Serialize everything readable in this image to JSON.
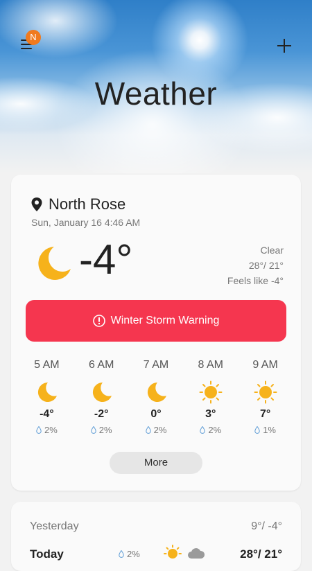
{
  "header": {
    "title": "Weather",
    "badge": "N",
    "menu_icon": "hamburger-icon",
    "add_icon": "plus-icon"
  },
  "current": {
    "location": "North Rose",
    "datetime": "Sun, January 16 4:46 AM",
    "temperature": "-4°",
    "condition": "Clear",
    "high_low": "28°/ 21°",
    "feels_like": "Feels like -4°",
    "icon": "moon-icon"
  },
  "warning": {
    "label": "Winter Storm Warning",
    "icon": "alert-icon",
    "color": "#f5364f"
  },
  "hourly": [
    {
      "time": "5 AM",
      "icon": "moon",
      "temp": "-4°",
      "pop": "2%"
    },
    {
      "time": "6 AM",
      "icon": "moon",
      "temp": "-2°",
      "pop": "2%"
    },
    {
      "time": "7 AM",
      "icon": "moon",
      "temp": "0°",
      "pop": "2%"
    },
    {
      "time": "8 AM",
      "icon": "sun",
      "temp": "3°",
      "pop": "2%"
    },
    {
      "time": "9 AM",
      "icon": "sun",
      "temp": "7°",
      "pop": "1%"
    }
  ],
  "more_label": "More",
  "daily": {
    "yesterday_label": "Yesterday",
    "yesterday_temps": "9°/ -4°",
    "today_label": "Today",
    "today_pop": "2%",
    "today_temps": "28°/ 21°"
  },
  "colors": {
    "accent_badge": "#f07a1e",
    "moon": "#f6b21b",
    "sun": "#f6b21b"
  }
}
